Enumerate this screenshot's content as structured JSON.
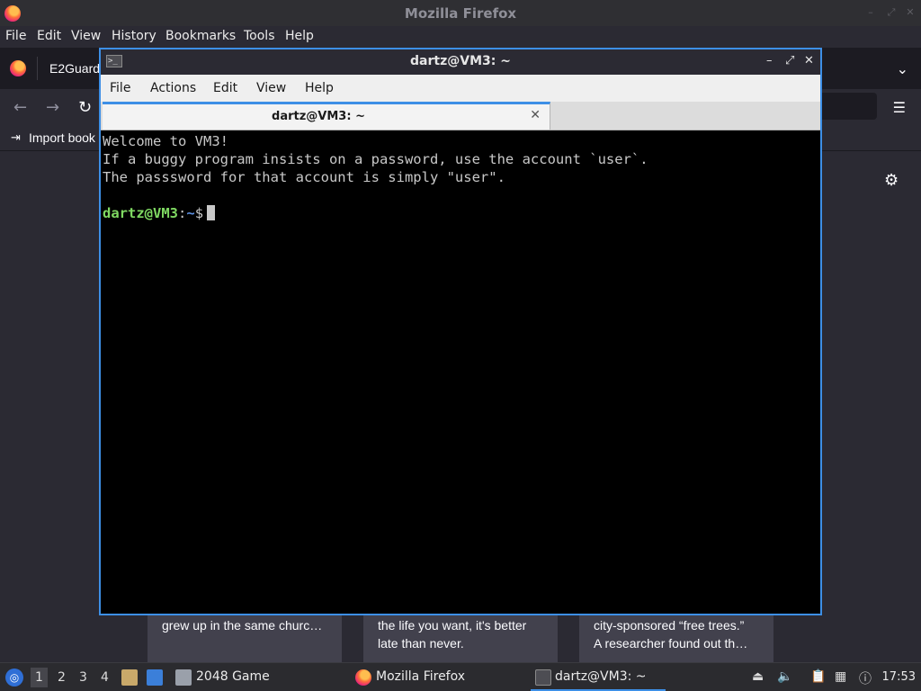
{
  "firefox": {
    "title": "Mozilla Firefox",
    "menu": [
      "File",
      "Edit",
      "View",
      "History",
      "Bookmarks",
      "Tools",
      "Help"
    ],
    "tab_label": "E2Guard",
    "bookmark_label": "Import book"
  },
  "cards": [
    {
      "lines": [
        "grew up in the same churc…"
      ]
    },
    {
      "lines": [
        "the life you want, it's better",
        "late than never."
      ]
    },
    {
      "lines": [
        "city-sponsored “free trees.”",
        "A researcher found out th…"
      ]
    }
  ],
  "terminal": {
    "title": "dartz@VM3: ~",
    "menu": [
      "File",
      "Actions",
      "Edit",
      "View",
      "Help"
    ],
    "tab_label": "dartz@VM3: ~",
    "output": [
      "Welcome to VM3!",
      "If a buggy program insists on a password, use the account `user`.",
      "The passsword for that account is simply \"user\"."
    ],
    "prompt_user": "dartz@VM3",
    "prompt_sep": ":",
    "prompt_path": "~",
    "prompt_symbol": "$"
  },
  "taskbar": {
    "workspaces": [
      "1",
      "2",
      "3",
      "4"
    ],
    "tasks": [
      "2048 Game",
      "Mozilla Firefox",
      "dartz@VM3: ~"
    ],
    "clock": "17:53"
  },
  "colors": {
    "accent": "#3d8fe6",
    "prompt_user": "#7fd962",
    "prompt_path": "#5c8fe0"
  }
}
